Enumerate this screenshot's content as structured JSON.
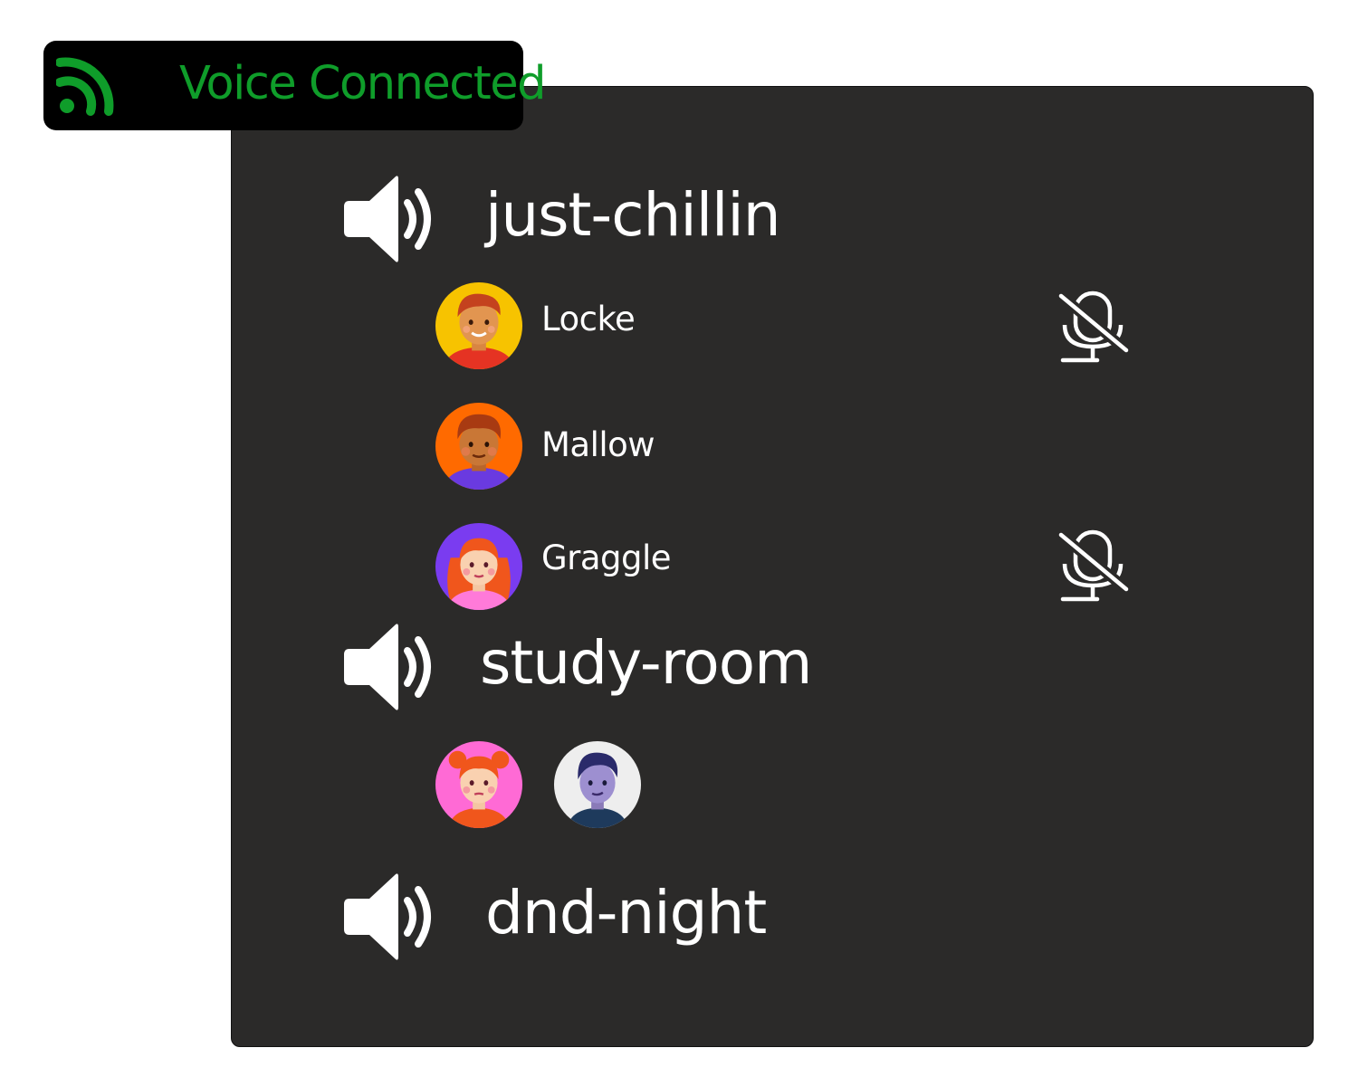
{
  "accent": "#0f9d2a",
  "status": {
    "label": "Voice Connected",
    "icon": "signal-icon"
  },
  "channels": [
    {
      "name": "just-chillin",
      "icon": "speaker-icon",
      "members": [
        {
          "name": "Locke",
          "muted": true,
          "avatar_bg": "#f7c300"
        },
        {
          "name": "Mallow",
          "muted": false,
          "avatar_bg": "#ff6a00"
        },
        {
          "name": "Graggle",
          "muted": true,
          "avatar_bg": "#7a3cf0"
        }
      ]
    },
    {
      "name": "study-room",
      "icon": "speaker-icon",
      "members": [
        {
          "avatar_bg": "#ff6ad5"
        },
        {
          "avatar_bg": "#eeeeee"
        }
      ]
    },
    {
      "name": "dnd-night",
      "icon": "speaker-icon",
      "members": []
    }
  ]
}
